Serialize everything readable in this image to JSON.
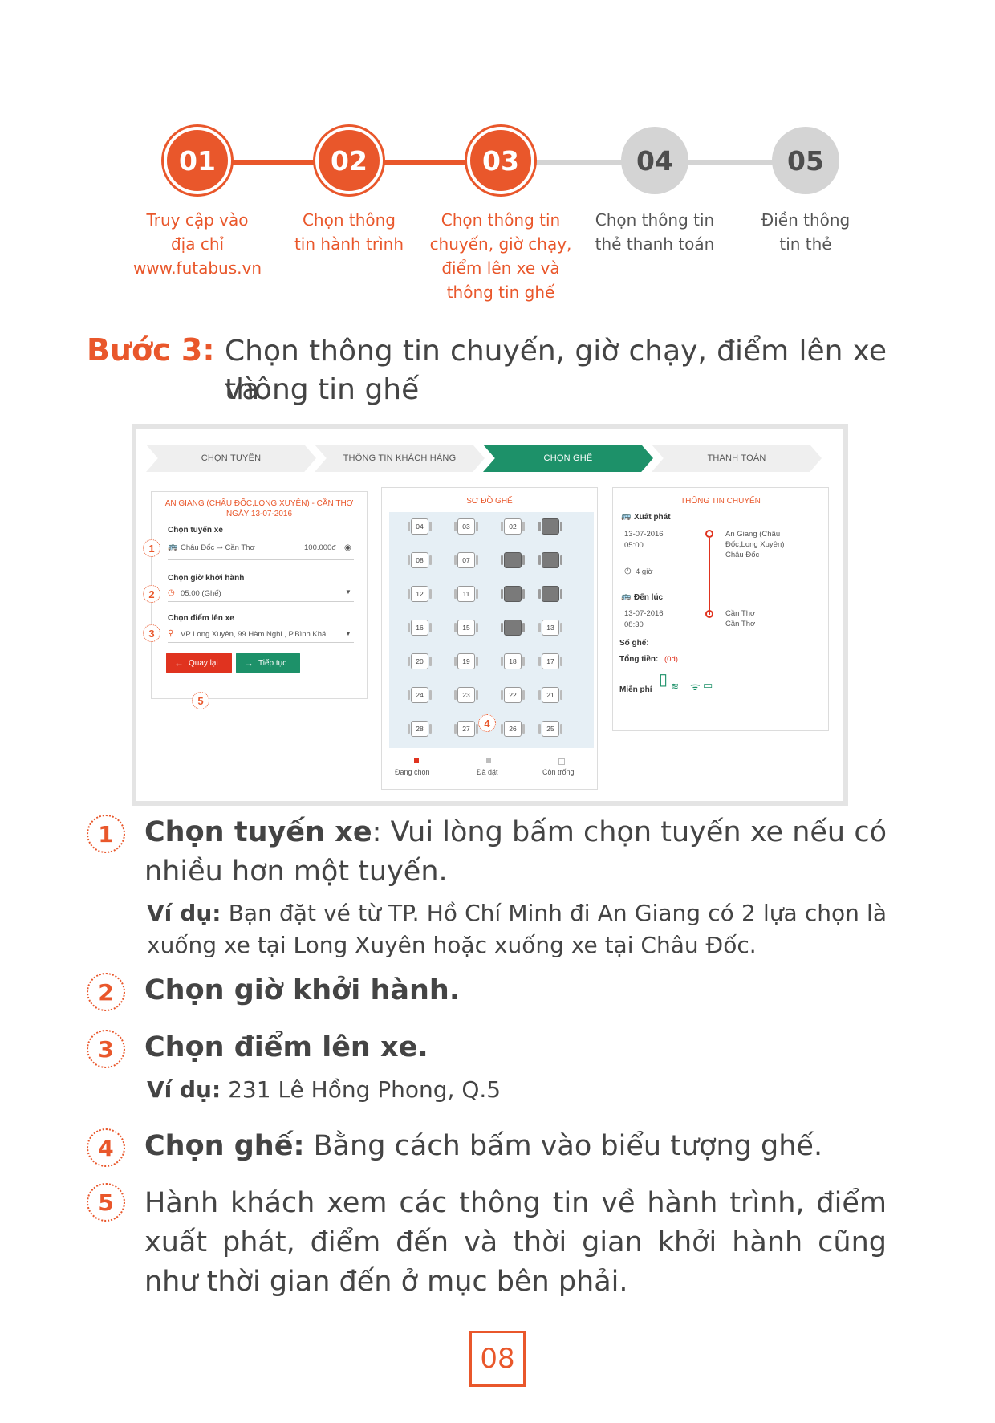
{
  "steps": [
    {
      "num": "01",
      "label": "Truy cập vào\nđịa chỉ\nwww.futabus.vn",
      "active": true
    },
    {
      "num": "02",
      "label": "Chọn thông\ntin hành trình",
      "active": true
    },
    {
      "num": "03",
      "label": "Chọn thông tin\nchuyến, giờ chạy,\nđiểm lên xe và\nthông tin ghế",
      "active": true
    },
    {
      "num": "04",
      "label": "Chọn thông tin\nthẻ thanh toán",
      "active": false
    },
    {
      "num": "05",
      "label": "Điền thông\ntin thẻ",
      "active": false
    }
  ],
  "colors": {
    "accent": "#e9572b",
    "green": "#1d9169",
    "inactive": "#d4d4d4"
  },
  "heading": {
    "step": "Bước 3:",
    "text_line1": "Chọn thông tin chuyến, giờ chạy, điểm lên xe và",
    "text_line2": "thông tin ghế"
  },
  "screenshot": {
    "tabs": [
      "CHỌN TUYẾN",
      "THÔNG TIN KHÁCH HÀNG",
      "CHỌN GHẾ",
      "THANH TOÁN"
    ],
    "active_tab": 2,
    "left": {
      "title_line1": "AN GIANG (CHÂU ĐỐC,LONG XUYÊN) - CẦN THƠ",
      "title_line2": "NGÀY 13-07-2016",
      "route_label": "Chọn tuyến xe",
      "route_value": "Châu Đốc ⇒ Cần Thơ",
      "route_price": "100.000đ",
      "time_label": "Chọn giờ khởi hành",
      "time_value": "05:00 (Ghế)",
      "pickup_label": "Chọn điểm lên xe",
      "pickup_value": "VP Long Xuyên, 99 Hàm Nghi , P.Bình Khá",
      "back_button": "Quay lại",
      "next_button": "Tiếp tục"
    },
    "seatmap": {
      "title": "SƠ ĐỒ GHẾ",
      "rows": [
        [
          {
            "n": "04",
            "b": false
          },
          {
            "n": "03",
            "b": false
          },
          {
            "n": "02",
            "b": false
          },
          {
            "n": "",
            "b": true
          }
        ],
        [
          {
            "n": "08",
            "b": false
          },
          {
            "n": "07",
            "b": false
          },
          {
            "n": "",
            "b": true
          },
          {
            "n": "",
            "b": true
          }
        ],
        [
          {
            "n": "12",
            "b": false
          },
          {
            "n": "11",
            "b": false
          },
          {
            "n": "",
            "b": true
          },
          {
            "n": "",
            "b": true
          }
        ],
        [
          {
            "n": "16",
            "b": false
          },
          {
            "n": "15",
            "b": false
          },
          {
            "n": "",
            "b": true
          },
          {
            "n": "13",
            "b": false
          }
        ],
        [
          {
            "n": "20",
            "b": false
          },
          {
            "n": "19",
            "b": false
          },
          {
            "n": "18",
            "b": false
          },
          {
            "n": "17",
            "b": false
          }
        ],
        [
          {
            "n": "24",
            "b": false
          },
          {
            "n": "23",
            "b": false
          },
          {
            "n": "22",
            "b": false
          },
          {
            "n": "21",
            "b": false
          }
        ],
        [
          {
            "n": "28",
            "b": false
          },
          {
            "n": "27",
            "b": false
          },
          {
            "n": "26",
            "b": false
          },
          {
            "n": "25",
            "b": false
          }
        ]
      ],
      "legend": [
        "Đang chọn",
        "Đã đặt",
        "Còn trống"
      ]
    },
    "trip": {
      "title": "THÔNG TIN CHUYẾN",
      "depart_label": "Xuất phát",
      "depart_date": "13-07-2016",
      "depart_time": "05:00",
      "depart_place_1": "An Giang (Châu",
      "depart_place_2": "Đốc,Long Xuyên)",
      "depart_place_3": "Châu Đốc",
      "duration": "4 giờ",
      "arrive_label": "Đến lúc",
      "arrive_date": "13-07-2016",
      "arrive_time": "08:30",
      "arrive_place_1": "Cần Thơ",
      "arrive_place_2": "Cần Thơ",
      "seats_label": "Số ghế:",
      "total_label": "Tổng tiền:",
      "total_value": "(0đ)",
      "free_label": "Miễn phí"
    },
    "markers": [
      "1",
      "2",
      "3",
      "4",
      "5"
    ]
  },
  "instructions": [
    {
      "num": "1",
      "bold": "Chọn tuyến xe",
      "text": ": Vui lòng bấm chọn tuyến xe nếu có nhiều hơn một tuyến.",
      "example_label": "Ví dụ:",
      "example": " Bạn đặt vé từ TP. Hồ Chí Minh đi An Giang có 2 lựa chọn là xuống xe tại Long Xuyên hoặc xuống xe tại Châu Đốc."
    },
    {
      "num": "2",
      "bold": "Chọn giờ khởi hành.",
      "text": ""
    },
    {
      "num": "3",
      "bold": "Chọn điểm lên xe.",
      "text": "",
      "example_label": "Ví dụ:",
      "example": " 231 Lê Hồng Phong, Q.5"
    },
    {
      "num": "4",
      "bold": "Chọn ghế:",
      "text": " Bằng cách bấm vào biểu tượng ghế."
    },
    {
      "num": "5",
      "bold": "",
      "text": "Hành khách xem các thông tin về hành trình, điểm xuất phát, điểm đến và thời gian khởi hành cũng như thời gian đến ở mục bên phải."
    }
  ],
  "page_number": "08"
}
